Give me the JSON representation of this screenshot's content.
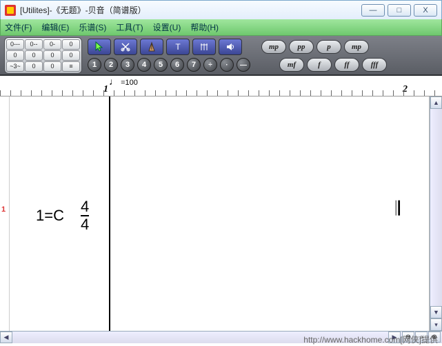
{
  "window": {
    "title": "[Utilites]-《无题》-贝音（简谱版）",
    "buttons": {
      "min": "—",
      "max": "□",
      "close": "X"
    }
  },
  "menu": {
    "file": "文件(F)",
    "edit": "编辑(E)",
    "score": "乐谱(S)",
    "tools": "工具(T)",
    "settings": "设置(U)",
    "help": "帮助(H)"
  },
  "palette": {
    "cells": [
      "0---",
      "0--",
      "0-",
      "0",
      "0",
      "0",
      "0",
      "0",
      "~3~",
      "0",
      "0",
      "≡"
    ]
  },
  "dynamics_top": [
    "mp",
    "pp",
    "p",
    "mp"
  ],
  "dynamics_bottom": [
    "mf",
    "f",
    "ff",
    "fff"
  ],
  "number_row": [
    "1",
    "2",
    "3",
    "4",
    "5",
    "6",
    "7",
    "÷",
    "·",
    "—"
  ],
  "ruler": {
    "tempo_note": "♩",
    "tempo_value": "=100",
    "marker1": "1",
    "marker2": "2"
  },
  "canvas": {
    "line_number": "1",
    "key_signature": "1=C",
    "time_num": "4",
    "time_den": "4",
    "barline": "𝄂"
  },
  "watermark": "http://www.hackhome.com[网侠]提供"
}
